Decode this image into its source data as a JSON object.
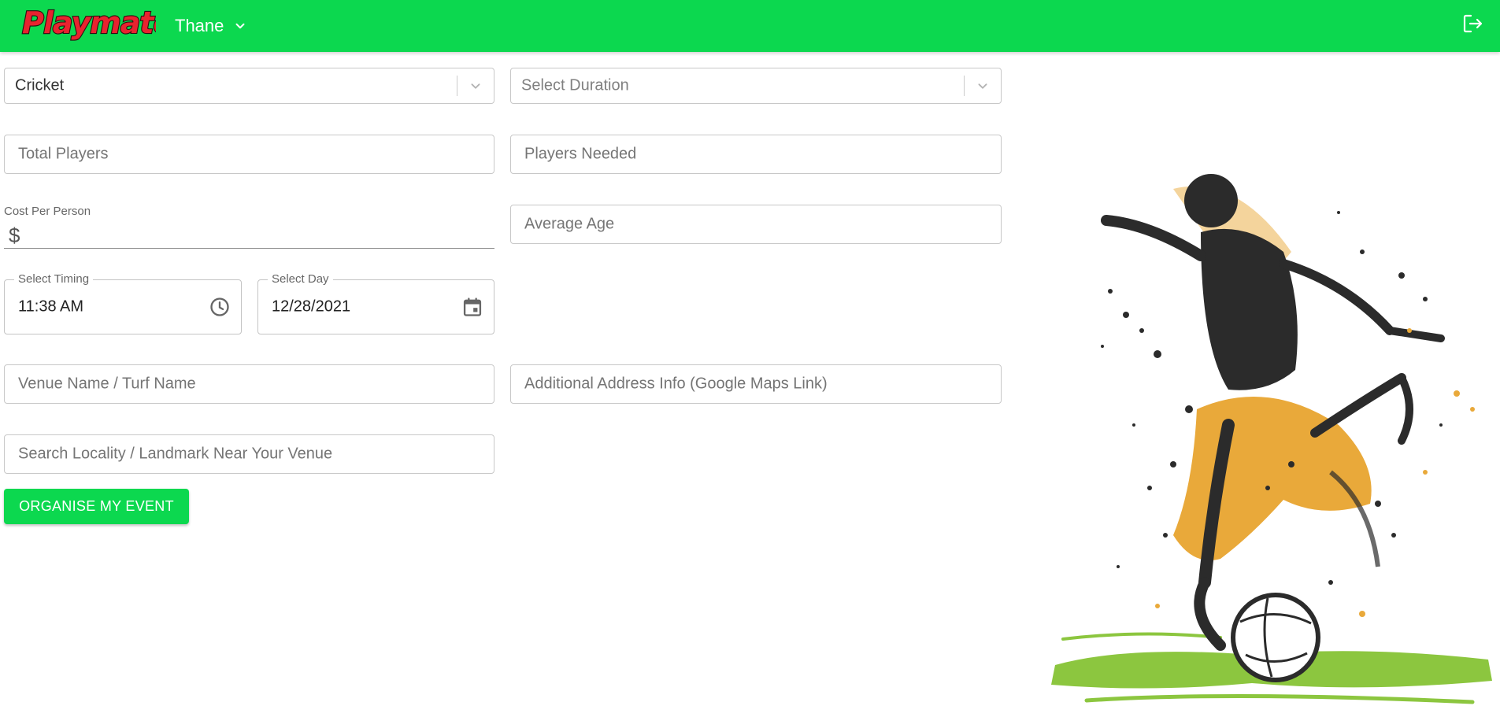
{
  "header": {
    "logo_text": "Playmate",
    "city": "Thane",
    "icons": {
      "city_dropdown": "chevron-down-icon",
      "logout": "logout-icon"
    }
  },
  "form": {
    "sport_select": {
      "value": "Cricket"
    },
    "duration_select": {
      "placeholder": "Select Duration"
    },
    "total_players": {
      "placeholder": "Total Players"
    },
    "players_needed": {
      "placeholder": "Players Needed"
    },
    "cost_per_person": {
      "label": "Cost Per Person",
      "currency_symbol": "$"
    },
    "average_age": {
      "placeholder": "Average Age"
    },
    "timing": {
      "label": "Select Timing",
      "value": "11:38 AM",
      "icon": "clock-icon"
    },
    "day": {
      "label": "Select Day",
      "value": "12/28/2021",
      "icon": "calendar-icon"
    },
    "venue_name": {
      "placeholder": "Venue Name / Turf Name"
    },
    "address_info": {
      "placeholder": "Additional Address Info (Google Maps Link)"
    },
    "locality_search": {
      "placeholder": "Search Locality / Landmark Near Your Venue"
    },
    "submit_label": "ORGANISE MY EVENT"
  },
  "hero": {
    "illustration": "soccer-player-kicking-ball"
  },
  "colors": {
    "brand_green": "#0cd84f",
    "splash_orange": "#e9a93a",
    "grass_green": "#8cc63f",
    "ink": "#2b2b2b"
  }
}
